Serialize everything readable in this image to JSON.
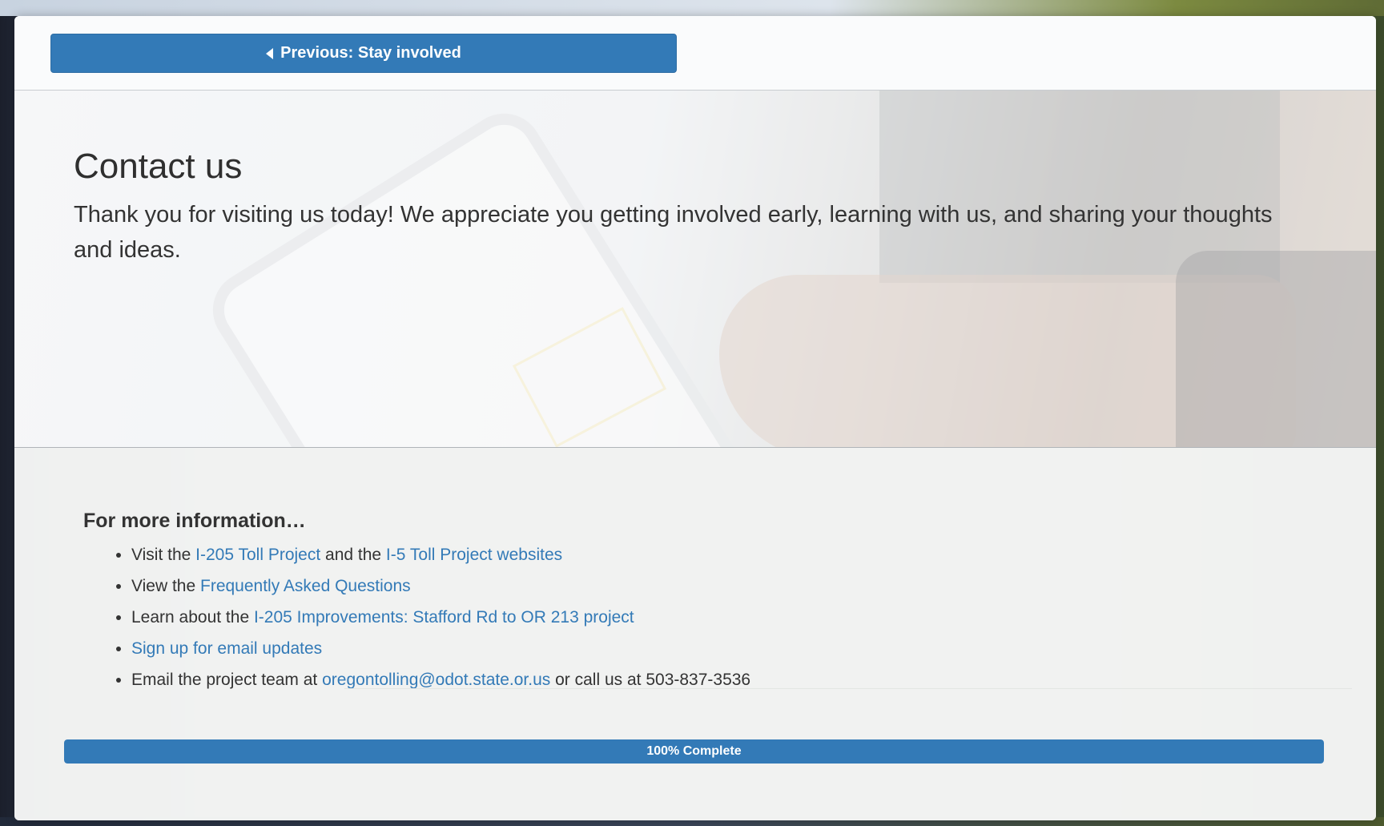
{
  "nav": {
    "previous_label": "Previous: Stay involved"
  },
  "hero": {
    "title": "Contact us",
    "text": "Thank you for visiting us today! We appreciate you getting involved early, learning with us, and sharing your thoughts and ideas."
  },
  "info": {
    "heading": "For more information…",
    "items": [
      {
        "prefix": "Visit the ",
        "link1": "I-205 Toll Project",
        "middle": " and the ",
        "link2": "I-5 Toll Project websites"
      },
      {
        "prefix": "View the ",
        "link": "Frequently Asked Questions"
      },
      {
        "prefix": "Learn about the ",
        "link": "I-205 Improvements: Stafford Rd to OR 213 project"
      },
      {
        "link": "Sign up for email updates"
      },
      {
        "prefix": "Email the project team at ",
        "link": "oregontolling@odot.state.or.us",
        "suffix": " or call us at 503-837-3536"
      }
    ]
  },
  "progress": {
    "value_percent": 100,
    "label": "100% Complete"
  },
  "colors": {
    "accent": "#337ab7",
    "text": "#333333"
  },
  "icons": {
    "previous": "caret-left-icon"
  }
}
